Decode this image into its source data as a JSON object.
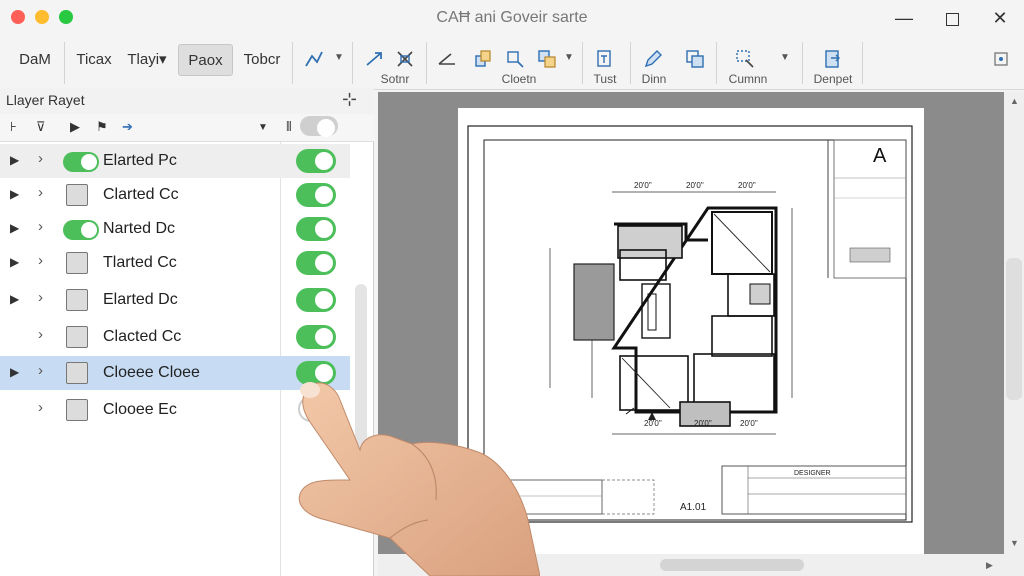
{
  "window": {
    "title": "CAĦ ani Goveir sarte",
    "controls": {
      "minimize": "—",
      "close": "✕"
    }
  },
  "toolbar": {
    "tabs": [
      "DaM",
      "Ticax",
      "Tlayi▾",
      "Paox",
      "Tobcr"
    ],
    "active_tab": "Paox",
    "groups": [
      "Sotnr",
      "Cloetn",
      "Tust",
      "Dinn",
      "Cumnn",
      "Denpet"
    ]
  },
  "layers": {
    "panel_title": "Llayer Rayet",
    "pin_icon": "⊹",
    "rows": [
      {
        "label": "Elarted Pc",
        "visible": true
      },
      {
        "label": "Clarted Cc",
        "visible": true
      },
      {
        "label": "Narted Dc",
        "visible": true
      },
      {
        "label": "Tlarted Cc",
        "visible": true
      },
      {
        "label": "Elarted Dc",
        "visible": true
      },
      {
        "label": "Clacted Cc",
        "visible": true
      },
      {
        "label": "Cloeee Cloee",
        "visible": true,
        "selected": true
      },
      {
        "label": "Clooee Ec",
        "visible": false
      }
    ]
  },
  "drawing": {
    "dims_top": [
      "20'0\"",
      "20'0\"",
      "20'0\""
    ],
    "dims_bottom": [
      "20'0\"",
      "20'0\"",
      "20'0\""
    ],
    "sheet_letter": "A",
    "title_block_name": "DESIGNER",
    "sheet_id": "A1.01"
  },
  "colors": {
    "toggle_on": "#4cbf5a",
    "selection": "#c7dcf3",
    "canvas_bg": "#8b8b8b"
  }
}
